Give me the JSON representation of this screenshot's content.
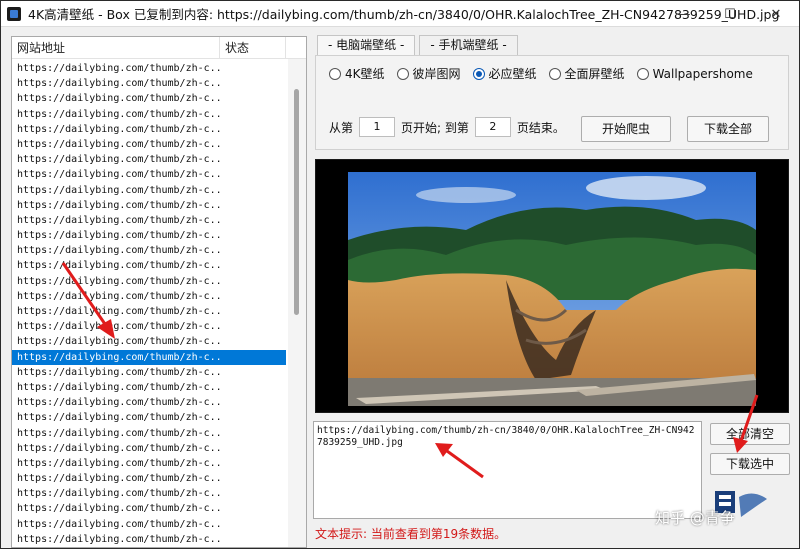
{
  "window": {
    "title": "4K高清壁纸 - Box   已复制到内容: https://dailybing.com/thumb/zh-cn/3840/0/OHR.KalalochTree_ZH-CN9427839259_UHD.jpg",
    "minimize": "—",
    "maximize": "☐",
    "close": "✕"
  },
  "list": {
    "columns": [
      "网站地址",
      "状态"
    ],
    "rows": [
      "https://dailybing.com/thumb/zh-c...",
      "https://dailybing.com/thumb/zh-c...",
      "https://dailybing.com/thumb/zh-c...",
      "https://dailybing.com/thumb/zh-c...",
      "https://dailybing.com/thumb/zh-c...",
      "https://dailybing.com/thumb/zh-c...",
      "https://dailybing.com/thumb/zh-c...",
      "https://dailybing.com/thumb/zh-c...",
      "https://dailybing.com/thumb/zh-c...",
      "https://dailybing.com/thumb/zh-c...",
      "https://dailybing.com/thumb/zh-c...",
      "https://dailybing.com/thumb/zh-c...",
      "https://dailybing.com/thumb/zh-c...",
      "https://dailybing.com/thumb/zh-c...",
      "https://dailybing.com/thumb/zh-c...",
      "https://dailybing.com/thumb/zh-c...",
      "https://dailybing.com/thumb/zh-c...",
      "https://dailybing.com/thumb/zh-c...",
      "https://dailybing.com/thumb/zh-c...",
      "https://dailybing.com/thumb/zh-c...",
      "https://dailybing.com/thumb/zh-c...",
      "https://dailybing.com/thumb/zh-c...",
      "https://dailybing.com/thumb/zh-c...",
      "https://dailybing.com/thumb/zh-c...",
      "https://dailybing.com/thumb/zh-c...",
      "https://dailybing.com/thumb/zh-c...",
      "https://dailybing.com/thumb/zh-c...",
      "https://dailybing.com/thumb/zh-c...",
      "https://dailybing.com/thumb/zh-c...",
      "https://dailybing.com/thumb/zh-c...",
      "https://dailybing.com/thumb/zh-c...",
      "https://dailybing.com/thumb/zh-c..."
    ],
    "selected_index": 19
  },
  "tabs": [
    "电脑端壁纸",
    "手机端壁纸"
  ],
  "sources": [
    {
      "label": "4K壁纸",
      "checked": false
    },
    {
      "label": "彼岸图网",
      "checked": false
    },
    {
      "label": "必应壁纸",
      "checked": true
    },
    {
      "label": "全面屏壁纸",
      "checked": false
    },
    {
      "label": "Wallpapershome",
      "checked": false
    }
  ],
  "pages": {
    "from_label": "从第",
    "start_value": "1",
    "start_suffix": "页开始; 到第",
    "end_value": "2",
    "end_suffix": "页结束。"
  },
  "buttons": {
    "start_crawl": "开始爬虫",
    "download_all": "下载全部",
    "clear_all": "全部清空",
    "download_selected": "下载选中"
  },
  "url_box": "https://dailybing.com/thumb/zh-cn/3840/0/OHR.KalalochTree_ZH-CN9427839259_UHD.jpg",
  "hint": "文本提示: 当前查看到第19条数据。",
  "watermark": "知乎 @青争",
  "colors": {
    "selection": "#0078d7",
    "hint": "#d21818",
    "annotation_arrow": "#e01c1c"
  }
}
